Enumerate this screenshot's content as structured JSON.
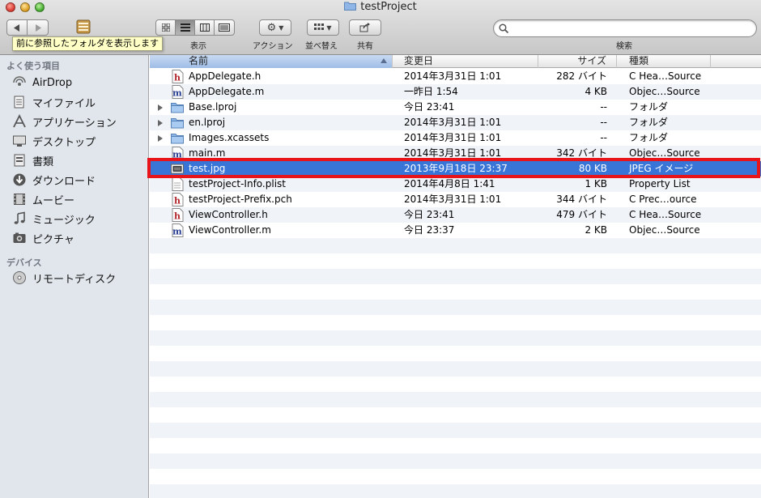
{
  "window": {
    "title": "testProject"
  },
  "toolbar": {
    "tooltip": "前に参照したフォルダを表示します",
    "view_label": "表示",
    "action_label": "アクション",
    "arrange_label": "並べ替え",
    "share_label": "共有",
    "search_label": "検索",
    "search_placeholder": ""
  },
  "sidebar": {
    "favorites_heading": "よく使う項目",
    "favorites": [
      {
        "label": "AirDrop",
        "icon": "airdrop-icon"
      },
      {
        "label": "マイファイル",
        "icon": "all-my-files-icon"
      },
      {
        "label": "アプリケーション",
        "icon": "applications-icon"
      },
      {
        "label": "デスクトップ",
        "icon": "desktop-icon"
      },
      {
        "label": "書類",
        "icon": "documents-icon"
      },
      {
        "label": "ダウンロード",
        "icon": "downloads-icon"
      },
      {
        "label": "ムービー",
        "icon": "movies-icon"
      },
      {
        "label": "ミュージック",
        "icon": "music-icon"
      },
      {
        "label": "ピクチャ",
        "icon": "pictures-icon"
      }
    ],
    "devices_heading": "デバイス",
    "devices": [
      {
        "label": "リモートディスク",
        "icon": "remote-disc-icon"
      }
    ]
  },
  "columns": {
    "name": "名前",
    "date": "変更日",
    "size": "サイズ",
    "kind": "種類"
  },
  "files": [
    {
      "name": "AppDelegate.h",
      "date": "2014年3月31日 1:01",
      "size": "282 バイト",
      "kind": "C Hea…Source",
      "icon": "h"
    },
    {
      "name": "AppDelegate.m",
      "date": "一昨日 1:54",
      "size": "4 KB",
      "kind": "Objec…Source",
      "icon": "m"
    },
    {
      "name": "Base.lproj",
      "date": "今日 23:41",
      "size": "--",
      "kind": "フォルダ",
      "icon": "folder"
    },
    {
      "name": "en.lproj",
      "date": "2014年3月31日 1:01",
      "size": "--",
      "kind": "フォルダ",
      "icon": "folder"
    },
    {
      "name": "Images.xcassets",
      "date": "2014年3月31日 1:01",
      "size": "--",
      "kind": "フォルダ",
      "icon": "folder"
    },
    {
      "name": "main.m",
      "date": "2014年3月31日 1:01",
      "size": "342 バイト",
      "kind": "Objec…Source",
      "icon": "m"
    },
    {
      "name": "test.jpg",
      "date": "2013年9月18日 23:37",
      "size": "80 KB",
      "kind": "JPEG イメージ",
      "icon": "jpg"
    },
    {
      "name": "testProject-Info.plist",
      "date": "2014年4月8日 1:41",
      "size": "1 KB",
      "kind": "Property List",
      "icon": "plist"
    },
    {
      "name": "testProject-Prefix.pch",
      "date": "2014年3月31日 1:01",
      "size": "344 バイト",
      "kind": "C Prec…ource",
      "icon": "h"
    },
    {
      "name": "ViewController.h",
      "date": "今日 23:41",
      "size": "479 バイト",
      "kind": "C Hea…Source",
      "icon": "h"
    },
    {
      "name": "ViewController.m",
      "date": "今日 23:37",
      "size": "2 KB",
      "kind": "Objec…Source",
      "icon": "m"
    }
  ],
  "selected_file": "test.jpg",
  "colors": {
    "selection": "#3875d7",
    "highlight_outline": "#e8141a",
    "sidebar_bg": "#e1e6ec"
  }
}
